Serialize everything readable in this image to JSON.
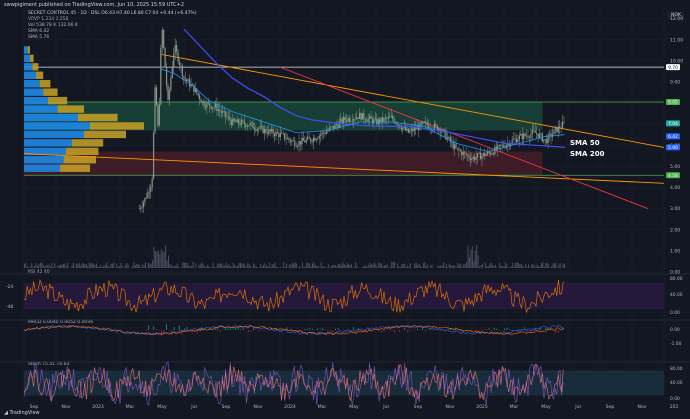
{
  "header": {
    "publisher_line": "swwpigiment published on TradingView.com, Jun 10, 2025 15:59 UTC+2"
  },
  "legend": {
    "symbol_line": "SECRET CONTROL 45 · 1D · DSL  O6.43  H7.40  L6.80  C7.04  +0.44 (+6.47%)",
    "vrvp_line": "VRVP  1.234  2.258",
    "vol_line": "Vol  538.78 K  132.66 K",
    "sma1_line": "SMA  6.42",
    "sma2_line": "SMA  5.76"
  },
  "currency": "NOK",
  "annotations": {
    "sma50": "SMA 50",
    "sma200": "SMA 200"
  },
  "price_tags": [
    {
      "label": "9.70",
      "value": 9.7,
      "bg": "#ffffff",
      "fg": "#131722"
    },
    {
      "label": "8.05",
      "value": 8.05,
      "bg": "#4caf50",
      "fg": "#ffffff"
    },
    {
      "label": "7.04",
      "value": 7.04,
      "bg": "#26a69a",
      "fg": "#ffffff"
    },
    {
      "label": "6.42",
      "value": 6.42,
      "bg": "#2962ff",
      "fg": "#ffffff"
    },
    {
      "label": "5.90",
      "value": 5.9,
      "bg": "#2962ff",
      "fg": "#ffffff"
    },
    {
      "label": "4.58",
      "value": 4.58,
      "bg": "#4caf50",
      "fg": "#ffffff"
    }
  ],
  "panes": {
    "rsi": {
      "label": "RSI  42  40",
      "left_ticks": [
        "-24",
        "-48"
      ],
      "right_ticks": [
        "80.00",
        "40.00",
        "0.00"
      ]
    },
    "macd": {
      "label": "MACD  0.0046  0.0052  0.0094",
      "right_ticks": [
        "0.00",
        "-1.00"
      ]
    },
    "stoch": {
      "label": "Stoch  75.41  74.03",
      "right_ticks": [
        "80.00",
        "40.00",
        "0.00"
      ]
    }
  },
  "branding": "TradingView",
  "colors": {
    "bg": "#131722",
    "grid": "#1e2230",
    "candle": "#8a9a8a",
    "sma50": "#2196f3",
    "sma200": "#3f51f0",
    "channel": "#ff9800",
    "red_line": "#f23645",
    "zone_green": "#1b4d3e",
    "zone_red": "#4d1f29",
    "vp_blue": "#1e88e5",
    "vp_gold": "#c9a227",
    "rsi_line": "#f57c00",
    "rsi_band": "#311b4d",
    "macd_line": "#2962ff",
    "macd_signal": "#ff6d00",
    "stoch_k": "#7e57c2",
    "stoch_band": "#1d3a4d"
  },
  "chart_data": {
    "type": "candlestick",
    "x_ticks": [
      "Sep",
      "Nov",
      "2023",
      "Mar",
      "May",
      "Jul",
      "Sep",
      "Nov",
      "2024",
      "Mar",
      "May",
      "Jul",
      "Sep",
      "Nov",
      "2025",
      "Mar",
      "May",
      "Jul",
      "Sep",
      "Nov",
      "202"
    ],
    "y_ticks": [
      12,
      11,
      10,
      9,
      8,
      7,
      6,
      5,
      4,
      3,
      2,
      1,
      0
    ],
    "ylim": [
      0,
      12.5
    ],
    "x_domain": [
      0,
      20
    ],
    "horizontal_lines": [
      9.7,
      8.05,
      4.58
    ],
    "zones": [
      {
        "from": 6.7,
        "to": 8.05,
        "kind": "resistance",
        "color": "#1b4d3e"
      },
      {
        "from": 4.58,
        "to": 5.7,
        "kind": "support",
        "color": "#4d1f29"
      }
    ],
    "close_path": [
      [
        3.6,
        3.0
      ],
      [
        3.8,
        3.5
      ],
      [
        4.0,
        4.3
      ],
      [
        4.1,
        8.8
      ],
      [
        4.2,
        6.5
      ],
      [
        4.3,
        11.8
      ],
      [
        4.5,
        8.0
      ],
      [
        4.7,
        10.7
      ],
      [
        5.0,
        9.2
      ],
      [
        5.3,
        8.7
      ],
      [
        5.6,
        8.0
      ],
      [
        6.0,
        7.8
      ],
      [
        6.5,
        7.1
      ],
      [
        7.0,
        7.0
      ],
      [
        7.5,
        6.7
      ],
      [
        8.0,
        6.5
      ],
      [
        8.5,
        6.1
      ],
      [
        9.0,
        6.3
      ],
      [
        9.5,
        6.7
      ],
      [
        10.0,
        7.2
      ],
      [
        10.5,
        7.4
      ],
      [
        11.0,
        7.1
      ],
      [
        11.5,
        7.3
      ],
      [
        12.0,
        6.6
      ],
      [
        12.5,
        7.0
      ],
      [
        13.0,
        6.8
      ],
      [
        13.5,
        5.8
      ],
      [
        14.0,
        5.4
      ],
      [
        14.5,
        5.6
      ],
      [
        15.0,
        6.0
      ],
      [
        15.5,
        6.4
      ],
      [
        16.0,
        6.6
      ],
      [
        16.3,
        6.2
      ],
      [
        16.6,
        6.7
      ],
      [
        16.9,
        7.04
      ]
    ],
    "sma_50": [
      [
        4.3,
        9.6
      ],
      [
        4.7,
        9.4
      ],
      [
        5.2,
        8.9
      ],
      [
        5.8,
        8.1
      ],
      [
        6.5,
        7.6
      ],
      [
        7.5,
        7.1
      ],
      [
        8.5,
        6.6
      ],
      [
        9.5,
        6.7
      ],
      [
        10.5,
        7.1
      ],
      [
        11.5,
        7.1
      ],
      [
        12.5,
        6.9
      ],
      [
        13.5,
        6.1
      ],
      [
        14.5,
        5.7
      ],
      [
        15.5,
        6.1
      ],
      [
        16.3,
        6.42
      ],
      [
        16.9,
        6.5
      ]
    ],
    "sma_200": [
      [
        5.0,
        11.5
      ],
      [
        5.5,
        10.7
      ],
      [
        6.0,
        9.9
      ],
      [
        6.5,
        9.2
      ],
      [
        7.0,
        8.7
      ],
      [
        7.5,
        8.3
      ],
      [
        8.0,
        7.8
      ],
      [
        8.5,
        7.4
      ],
      [
        9.0,
        7.2
      ],
      [
        10.0,
        7.0
      ],
      [
        11.0,
        6.9
      ],
      [
        12.0,
        6.9
      ],
      [
        13.0,
        6.7
      ],
      [
        14.0,
        6.4
      ],
      [
        15.0,
        6.1
      ],
      [
        16.0,
        6.0
      ],
      [
        16.9,
        5.9
      ]
    ],
    "trendlines": [
      {
        "from": [
          4.3,
          10.3
        ],
        "to": [
          20.0,
          5.9
        ],
        "color": "#ff9800"
      },
      {
        "from": [
          0.0,
          5.6
        ],
        "to": [
          20.0,
          4.2
        ],
        "color": "#ff9800"
      },
      {
        "from": [
          8.0,
          9.7
        ],
        "to": [
          19.5,
          3.0
        ],
        "color": "#f23645"
      }
    ],
    "volume_profile": [
      {
        "price": 4.9,
        "total": 0.55,
        "up": 0.3
      },
      {
        "price": 5.3,
        "total": 0.6,
        "up": 0.33
      },
      {
        "price": 5.7,
        "total": 0.62,
        "up": 0.35
      },
      {
        "price": 6.1,
        "total": 0.66,
        "up": 0.4
      },
      {
        "price": 6.5,
        "total": 0.85,
        "up": 0.5
      },
      {
        "price": 6.9,
        "total": 1.0,
        "up": 0.55
      },
      {
        "price": 7.3,
        "total": 0.78,
        "up": 0.45
      },
      {
        "price": 7.7,
        "total": 0.5,
        "up": 0.28
      },
      {
        "price": 8.1,
        "total": 0.36,
        "up": 0.2
      },
      {
        "price": 8.5,
        "total": 0.28,
        "up": 0.16
      },
      {
        "price": 8.9,
        "total": 0.22,
        "up": 0.13
      },
      {
        "price": 9.3,
        "total": 0.16,
        "up": 0.1
      },
      {
        "price": 9.7,
        "total": 0.12,
        "up": 0.07
      },
      {
        "price": 10.1,
        "total": 0.08,
        "up": 0.05
      },
      {
        "price": 10.5,
        "total": 0.05,
        "up": 0.03
      }
    ]
  }
}
